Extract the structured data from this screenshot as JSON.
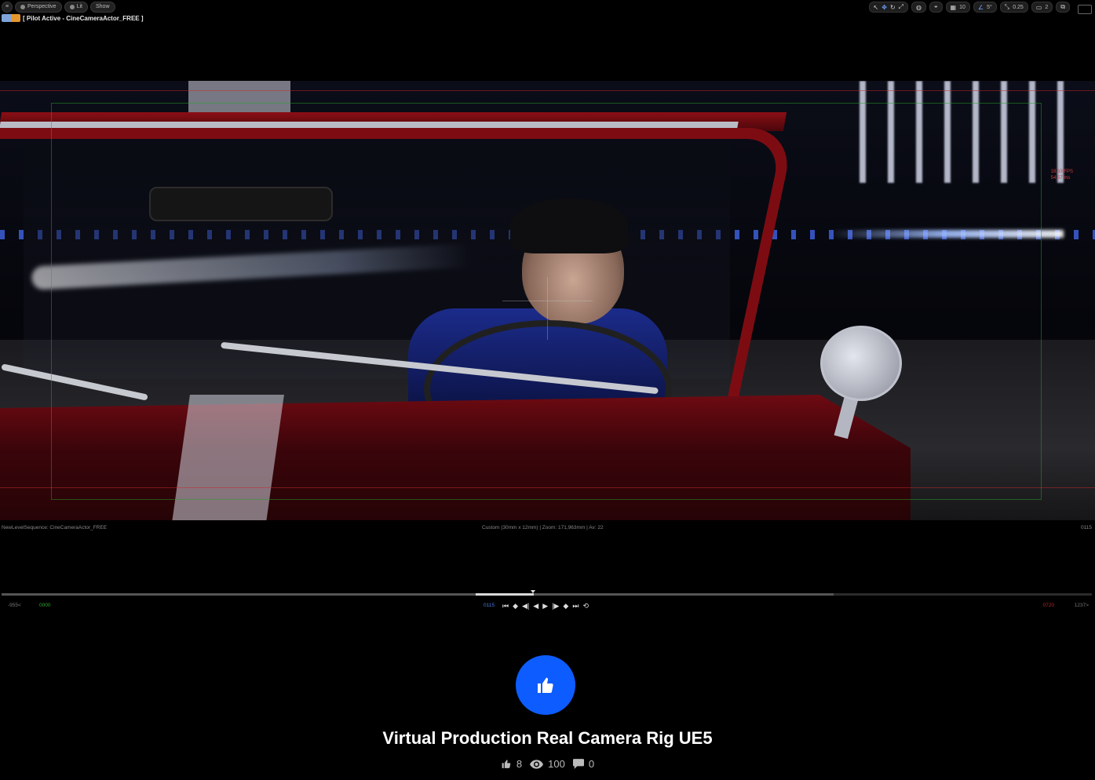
{
  "viewport_toolbar": {
    "menu_icon": "hamburger-icon",
    "perspective_label": "Perspective",
    "lit_label": "Lit",
    "show_label": "Show",
    "pilot_label": "[ Pilot Active - CineCameraActor_FREE ]"
  },
  "right_toolbar": {
    "grid_value": "10",
    "angle_value": "5°",
    "scale_value": "0.25",
    "camera_speed": "2"
  },
  "stats_overlay": {
    "fps": "18.33 FPS",
    "ms": "54.57 ms"
  },
  "viewport_info": {
    "sequence": "NewLevelSequence: CineCameraActor_FREE",
    "camera": "Custom (30mm x 12mm) | Zoom: 171,963mm | Av: 22",
    "frame": "0115"
  },
  "timeline": {
    "view_start": "-955<",
    "play_start": "0000",
    "current": "0115",
    "play_end": "0720",
    "view_end": "1237>"
  },
  "post": {
    "title": "Virtual Production Real Camera Rig UE5",
    "likes": "8",
    "views": "100",
    "comments": "0",
    "accent_color": "#0d5cff"
  }
}
